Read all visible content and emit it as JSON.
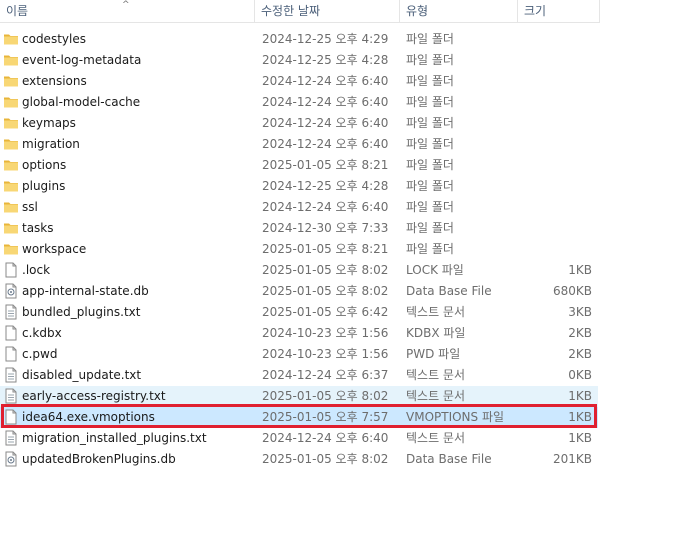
{
  "header": {
    "name": "이름",
    "date": "수정한 날짜",
    "type": "유형",
    "size": "크기",
    "sort_arrow": "^"
  },
  "files": [
    {
      "name": "codestyles",
      "date": "2024-12-25 오후 4:29",
      "type": "파일 폴더",
      "size": "",
      "icon": "folder-icon"
    },
    {
      "name": "event-log-metadata",
      "date": "2024-12-25 오후 4:28",
      "type": "파일 폴더",
      "size": "",
      "icon": "folder-icon"
    },
    {
      "name": "extensions",
      "date": "2024-12-24 오후 6:40",
      "type": "파일 폴더",
      "size": "",
      "icon": "folder-icon"
    },
    {
      "name": "global-model-cache",
      "date": "2024-12-24 오후 6:40",
      "type": "파일 폴더",
      "size": "",
      "icon": "folder-icon"
    },
    {
      "name": "keymaps",
      "date": "2024-12-24 오후 6:40",
      "type": "파일 폴더",
      "size": "",
      "icon": "folder-icon"
    },
    {
      "name": "migration",
      "date": "2024-12-24 오후 6:40",
      "type": "파일 폴더",
      "size": "",
      "icon": "folder-icon"
    },
    {
      "name": "options",
      "date": "2025-01-05 오후 8:21",
      "type": "파일 폴더",
      "size": "",
      "icon": "folder-icon"
    },
    {
      "name": "plugins",
      "date": "2024-12-25 오후 4:28",
      "type": "파일 폴더",
      "size": "",
      "icon": "folder-icon"
    },
    {
      "name": "ssl",
      "date": "2024-12-24 오후 6:40",
      "type": "파일 폴더",
      "size": "",
      "icon": "folder-icon"
    },
    {
      "name": "tasks",
      "date": "2024-12-30 오후 7:33",
      "type": "파일 폴더",
      "size": "",
      "icon": "folder-icon"
    },
    {
      "name": "workspace",
      "date": "2025-01-05 오후 8:21",
      "type": "파일 폴더",
      "size": "",
      "icon": "folder-icon"
    },
    {
      "name": ".lock",
      "date": "2025-01-05 오후 8:02",
      "type": "LOCK 파일",
      "size": "1KB",
      "icon": "file-icon"
    },
    {
      "name": "app-internal-state.db",
      "date": "2025-01-05 오후 8:02",
      "type": "Data Base File",
      "size": "680KB",
      "icon": "database-file-icon"
    },
    {
      "name": "bundled_plugins.txt",
      "date": "2025-01-05 오후 6:42",
      "type": "텍스트 문서",
      "size": "3KB",
      "icon": "text-file-icon"
    },
    {
      "name": "c.kdbx",
      "date": "2024-10-23 오후 1:56",
      "type": "KDBX 파일",
      "size": "2KB",
      "icon": "file-icon"
    },
    {
      "name": "c.pwd",
      "date": "2024-10-23 오후 1:56",
      "type": "PWD 파일",
      "size": "2KB",
      "icon": "file-icon"
    },
    {
      "name": "disabled_update.txt",
      "date": "2024-12-24 오후 6:37",
      "type": "텍스트 문서",
      "size": "0KB",
      "icon": "text-file-icon"
    },
    {
      "name": "early-access-registry.txt",
      "date": "2025-01-05 오후 8:02",
      "type": "텍스트 문서",
      "size": "1KB",
      "icon": "text-file-icon",
      "state": "hover"
    },
    {
      "name": "idea64.exe.vmoptions",
      "date": "2025-01-05 오후 7:57",
      "type": "VMOPTIONS 파일",
      "size": "1KB",
      "icon": "file-icon",
      "state": "selected"
    },
    {
      "name": "migration_installed_plugins.txt",
      "date": "2024-12-24 오후 6:40",
      "type": "텍스트 문서",
      "size": "1KB",
      "icon": "text-file-icon"
    },
    {
      "name": "updatedBrokenPlugins.db",
      "date": "2025-01-05 오후 8:02",
      "type": "Data Base File",
      "size": "201KB",
      "icon": "database-file-icon"
    }
  ],
  "colors": {
    "folder": "#f8d775",
    "folder_dark": "#e8b53a",
    "selected_bg": "#cce8ff",
    "hover_bg": "#e5f3fb",
    "highlight_border": "#e02030",
    "header_text": "#4c607a",
    "secondary_text": "#6d6d6d"
  }
}
